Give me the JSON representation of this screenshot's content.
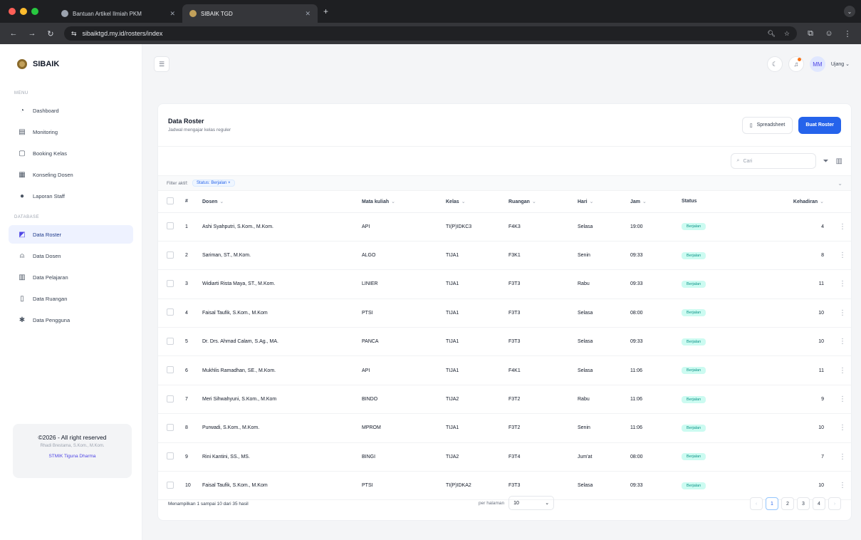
{
  "browser": {
    "tabs": [
      {
        "title": "Bantuan Artikel Ilmiah PKM",
        "active": false
      },
      {
        "title": "SIBAIK TGD",
        "active": true
      }
    ],
    "url": "sibaiktgd.my.id/rosters/index"
  },
  "app": {
    "brand": "SIBAIK",
    "user": {
      "initials": "MM",
      "name": "Ujang"
    }
  },
  "sidebar": {
    "section_main": "MENU",
    "section_data": "DATABASE",
    "menu": [
      {
        "label": "Dashboard",
        "icon": "dashboard-icon"
      },
      {
        "label": "Monitoring",
        "icon": "calendar-icon"
      },
      {
        "label": "Booking Kelas",
        "icon": "square-icon"
      },
      {
        "label": "Konseling Dosen",
        "icon": "chat-icon"
      },
      {
        "label": "Laporan Staff",
        "icon": "report-icon"
      }
    ],
    "data_menu": [
      {
        "label": "Data Roster",
        "icon": "roster-icon",
        "active": true
      },
      {
        "label": "Data Dosen",
        "icon": "user-icon"
      },
      {
        "label": "Data Pelajaran",
        "icon": "book-icon"
      },
      {
        "label": "Data Ruangan",
        "icon": "building-icon"
      },
      {
        "label": "Data Pengguna",
        "icon": "users-icon"
      }
    ],
    "footer": {
      "copyright": "©2026 - All right reserved",
      "author": "Rhadi Brestama, S.Kom., M.Kom.",
      "org": "STMIK Tiguna Dharma"
    }
  },
  "page": {
    "title": "Data Roster",
    "subtitle": "Jadwal mengajar kelas reguler",
    "spreadsheet_label": "Spreadsheet",
    "create_label": "Buat Roster",
    "search_placeholder": "Cari",
    "filter_label": "Filter aktif:",
    "filter_chip": "Status: Berjalan ×"
  },
  "table": {
    "headers": [
      "#",
      "Dosen",
      "Mata kuliah",
      "Kelas",
      "Ruangan",
      "Hari",
      "Jam",
      "Status",
      "Kehadiran"
    ],
    "rows": [
      {
        "no": "1",
        "dosen": "Ashi Syahputri, S.Kom., M.Kom.",
        "matkul": "API",
        "kelas": "TI(P)IDKC3",
        "ruangan": "F4K3",
        "hari": "Selasa",
        "jam": "19:00",
        "status": "Berjalan",
        "kehadiran": "4"
      },
      {
        "no": "2",
        "dosen": "Sariman, ST., M.Kom.",
        "matkul": "ALGO",
        "kelas": "TIJA1",
        "ruangan": "F3K1",
        "hari": "Senin",
        "jam": "09:33",
        "status": "Berjalan",
        "kehadiran": "8"
      },
      {
        "no": "3",
        "dosen": "Widiarti Rista Maya, ST., M.Kom.",
        "matkul": "LINIER",
        "kelas": "TIJA1",
        "ruangan": "F3T3",
        "hari": "Rabu",
        "jam": "09:33",
        "status": "Berjalan",
        "kehadiran": "11"
      },
      {
        "no": "4",
        "dosen": "Faisal Taufik, S.Kom., M.Kom",
        "matkul": "PTSI",
        "kelas": "TIJA1",
        "ruangan": "F3T3",
        "hari": "Selasa",
        "jam": "08:00",
        "status": "Berjalan",
        "kehadiran": "10"
      },
      {
        "no": "5",
        "dosen": "Dr. Drs. Ahmad Calam, S.Ag., MA.",
        "matkul": "PANCA",
        "kelas": "TIJA1",
        "ruangan": "F3T3",
        "hari": "Selasa",
        "jam": "09:33",
        "status": "Berjalan",
        "kehadiran": "10"
      },
      {
        "no": "6",
        "dosen": "Mukhlis Ramadhan, SE., M.Kom.",
        "matkul": "API",
        "kelas": "TIJA1",
        "ruangan": "F4K1",
        "hari": "Selasa",
        "jam": "11:06",
        "status": "Berjalan",
        "kehadiran": "11"
      },
      {
        "no": "7",
        "dosen": "Meri Sihwahyuni, S.Kom., M.Kom",
        "matkul": "BINDO",
        "kelas": "TIJA2",
        "ruangan": "F3T2",
        "hari": "Rabu",
        "jam": "11:06",
        "status": "Berjalan",
        "kehadiran": "9"
      },
      {
        "no": "8",
        "dosen": "Purwadi, S.Kom., M.Kom.",
        "matkul": "MPROM",
        "kelas": "TIJA1",
        "ruangan": "F3T2",
        "hari": "Senin",
        "jam": "11:06",
        "status": "Berjalan",
        "kehadiran": "10"
      },
      {
        "no": "9",
        "dosen": "Rini Kantini, SS., MS.",
        "matkul": "BINGI",
        "kelas": "TIJA2",
        "ruangan": "F3T4",
        "hari": "Jum'at",
        "jam": "08:00",
        "status": "Berjalan",
        "kehadiran": "7"
      },
      {
        "no": "10",
        "dosen": "Faisal Taufik, S.Kom., M.Kom",
        "matkul": "PTSI",
        "kelas": "TI(P)IDKA2",
        "ruangan": "F3T3",
        "hari": "Selasa",
        "jam": "09:33",
        "status": "Berjalan",
        "kehadiran": "10"
      }
    ]
  },
  "footer": {
    "info": "Menampilkan 1 sampai 10 dari 35 hasil",
    "perpage_label": "per halaman",
    "perpage_value": "10",
    "pages": [
      "‹",
      "1",
      "2",
      "3",
      "4",
      "›"
    ]
  }
}
